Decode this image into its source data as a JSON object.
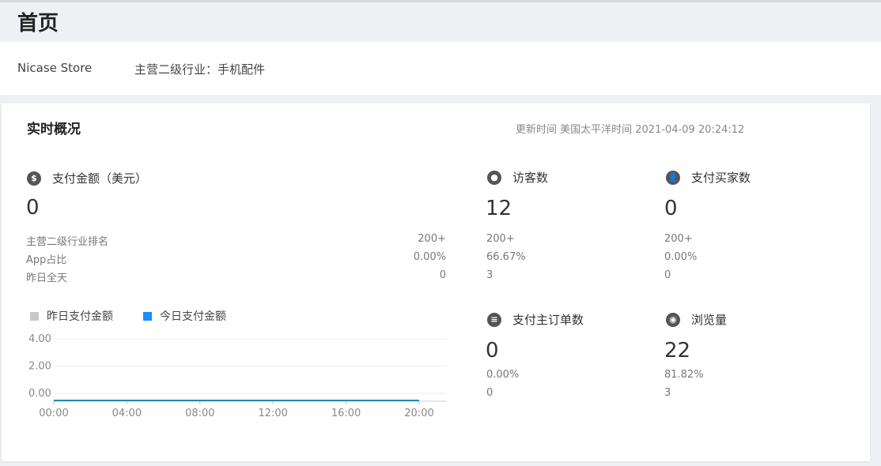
{
  "header": {
    "title": "首页"
  },
  "store": {
    "name": "Nicase Store",
    "industry": "主营二级行业：手机配件"
  },
  "overview": {
    "title": "实时概况",
    "update_time": "更新时间 美国太平洋时间 2021-04-09 20:24:12",
    "payment": {
      "icon": "dollar-icon",
      "label": "支付金额（美元）",
      "value": "0",
      "stats": [
        {
          "label": "主营二级行业排名",
          "value": "200+"
        },
        {
          "label": "App占比",
          "value": "0.00%"
        },
        {
          "label": "昨日全天",
          "value": "0"
        }
      ]
    },
    "visitors": {
      "icon": "footprint-icon",
      "label": "访客数",
      "value": "12",
      "stats": [
        "200+",
        "66.67%",
        "3"
      ]
    },
    "buyers": {
      "icon": "users-icon",
      "label": "支付买家数",
      "value": "0",
      "stats": [
        "200+",
        "0.00%",
        "0"
      ]
    },
    "orders": {
      "icon": "order-icon",
      "label": "支付主订单数",
      "value": "0",
      "stats": [
        "0.00%",
        "0"
      ]
    },
    "pageviews": {
      "icon": "eye-icon",
      "label": "浏览量",
      "value": "22",
      "stats": [
        "81.82%",
        "3"
      ]
    }
  },
  "colors": {
    "yesterday": "#c8c8c8",
    "today": "#1890ff",
    "line": "#1a8fb0"
  },
  "chart_data": {
    "type": "line",
    "x": [
      "00:00",
      "04:00",
      "08:00",
      "12:00",
      "16:00",
      "20:00"
    ],
    "yticks": [
      "4.00",
      "2.00",
      "0.00"
    ],
    "ylim": [
      0,
      4
    ],
    "series": [
      {
        "name": "昨日支付金额",
        "values": [
          0,
          0,
          0,
          0,
          0,
          0
        ]
      },
      {
        "name": "今日支付金额",
        "values": [
          0,
          0,
          0,
          0,
          0,
          0
        ]
      }
    ],
    "legend": "top-left",
    "grid": true
  }
}
